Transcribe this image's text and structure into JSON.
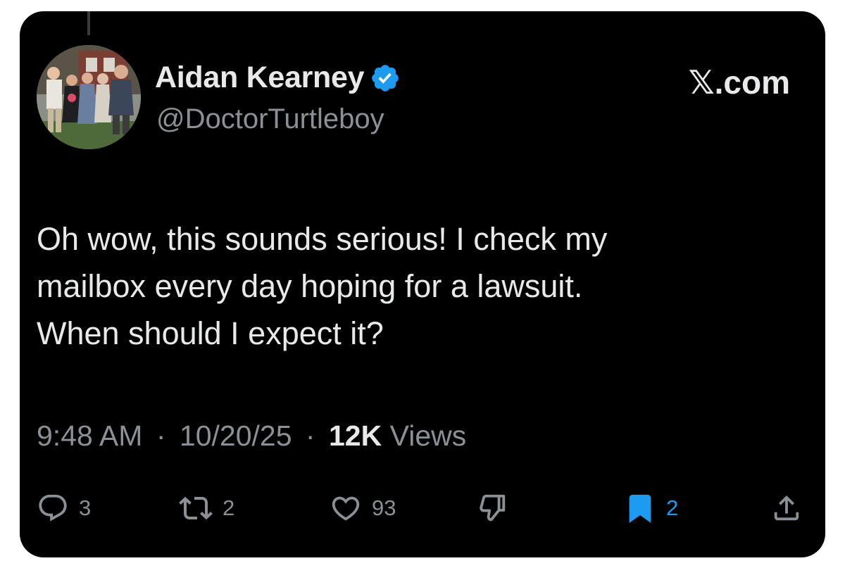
{
  "tweet": {
    "display_name": "Aidan Kearney",
    "handle": "@DoctorTurtleboy",
    "site_label": "𝕏.com",
    "verified": true,
    "body_lines": [
      "Oh wow, this sounds serious! I check my",
      "mailbox every day hoping for a lawsuit.",
      "When should I expect it?"
    ],
    "time": "9:48 AM",
    "separator": "·",
    "date": "10/20/25",
    "views_count": "12K",
    "views_label": "Views"
  },
  "actions": {
    "replies": "3",
    "reposts": "2",
    "likes": "93",
    "bookmarks": "2"
  },
  "icons": {
    "reply": "reply-icon",
    "repost": "repost-icon",
    "like": "heart-icon",
    "dislike": "dislike-icon",
    "bookmark": "bookmark-icon",
    "share": "share-icon",
    "verified": "verified-badge-icon"
  },
  "colors": {
    "background": "#000000",
    "text_primary": "#e7e9ea",
    "text_secondary": "#8b9096",
    "accent": "#1d9bf0"
  }
}
